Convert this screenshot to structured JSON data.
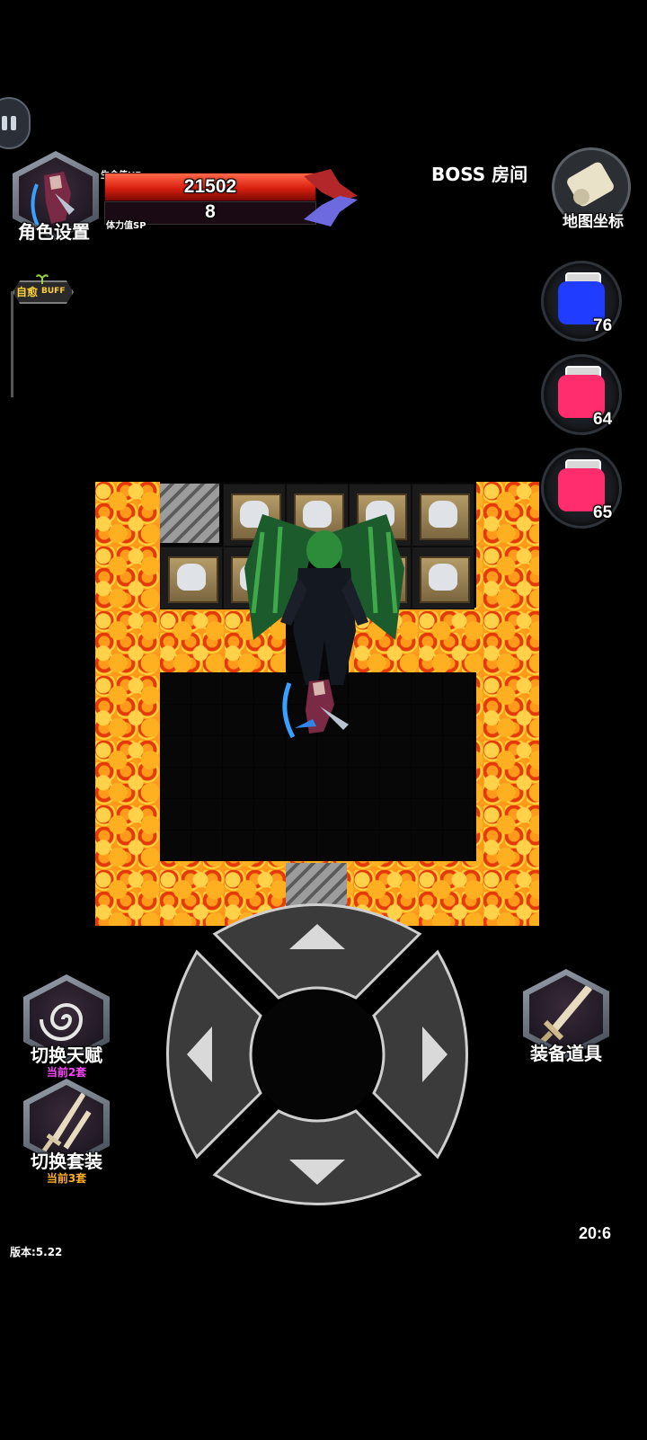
{
  "hud": {
    "role_settings": "角色设置",
    "hp_label": "生命值HP",
    "hp_value": "21502",
    "sp_label": "体力值SP",
    "sp_value": "8",
    "room_name": "BOSS  房间",
    "map_coords_label": "地图坐标",
    "self_heal": "自愈",
    "buff": "BUFF"
  },
  "potions": [
    {
      "color": "#1f3cff",
      "count": "76"
    },
    {
      "color": "#ff2d6e",
      "count": "64"
    },
    {
      "color": "#ff2d6e",
      "count": "65"
    }
  ],
  "skills": {
    "switch_talent": "切换天赋",
    "talent_current": "当前2套",
    "switch_set": "切换套装",
    "set_current": "当前3套",
    "equip_items": "装备道具"
  },
  "footer": {
    "version": "版本:5.22",
    "coords": "20:6"
  },
  "colors": {
    "hp_red": "#d9200f",
    "talent_sub": "#ff44ff",
    "set_sub": "#ffb020",
    "lava": "#ff7a12"
  },
  "icons": [
    "pause-icon",
    "scroll-map-icon",
    "swirl-icon",
    "daggers-icon",
    "sword-icon",
    "heal-sprout-icon"
  ]
}
